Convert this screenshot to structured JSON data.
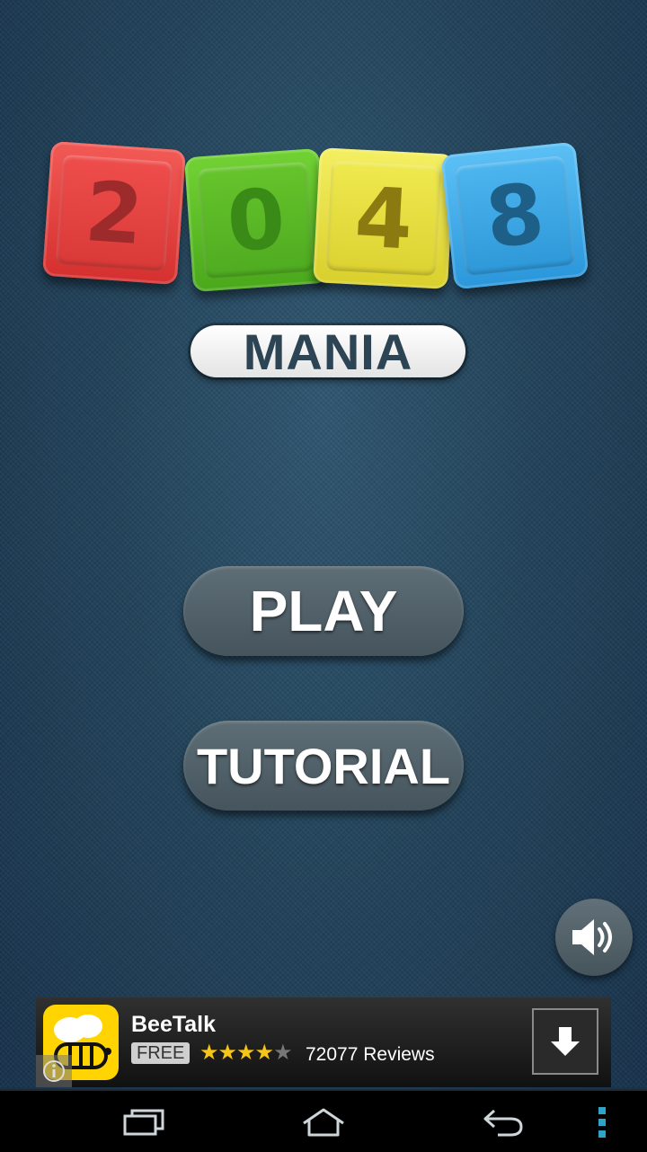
{
  "logo": {
    "tiles": [
      "2",
      "0",
      "4",
      "8"
    ],
    "subtitle": "MANIA",
    "tile_colors": [
      "#e8413f",
      "#5bb925",
      "#e9e247",
      "#3aa8e8"
    ]
  },
  "menu": {
    "play_label": "PLAY",
    "tutorial_label": "TUTORIAL"
  },
  "sound": {
    "icon": "speaker-icon",
    "state": "on"
  },
  "ad": {
    "app_name": "BeeTalk",
    "price_badge": "FREE",
    "rating": 4,
    "rating_max": 5,
    "stars_on": "★★★★",
    "stars_off": "★",
    "reviews": "72077 Reviews",
    "icon": "beetalk-icon",
    "download_icon": "download-arrow-icon",
    "info_icon": "info-icon"
  },
  "navbar": {
    "recent_icon": "recent-apps-icon",
    "home_icon": "home-icon",
    "back_icon": "back-icon",
    "menu_icon": "overflow-menu-icon"
  },
  "colors": {
    "background": "#22435a",
    "button": "#55646c",
    "ad_bg": "#1c1c1c",
    "star": "#f5c518"
  }
}
